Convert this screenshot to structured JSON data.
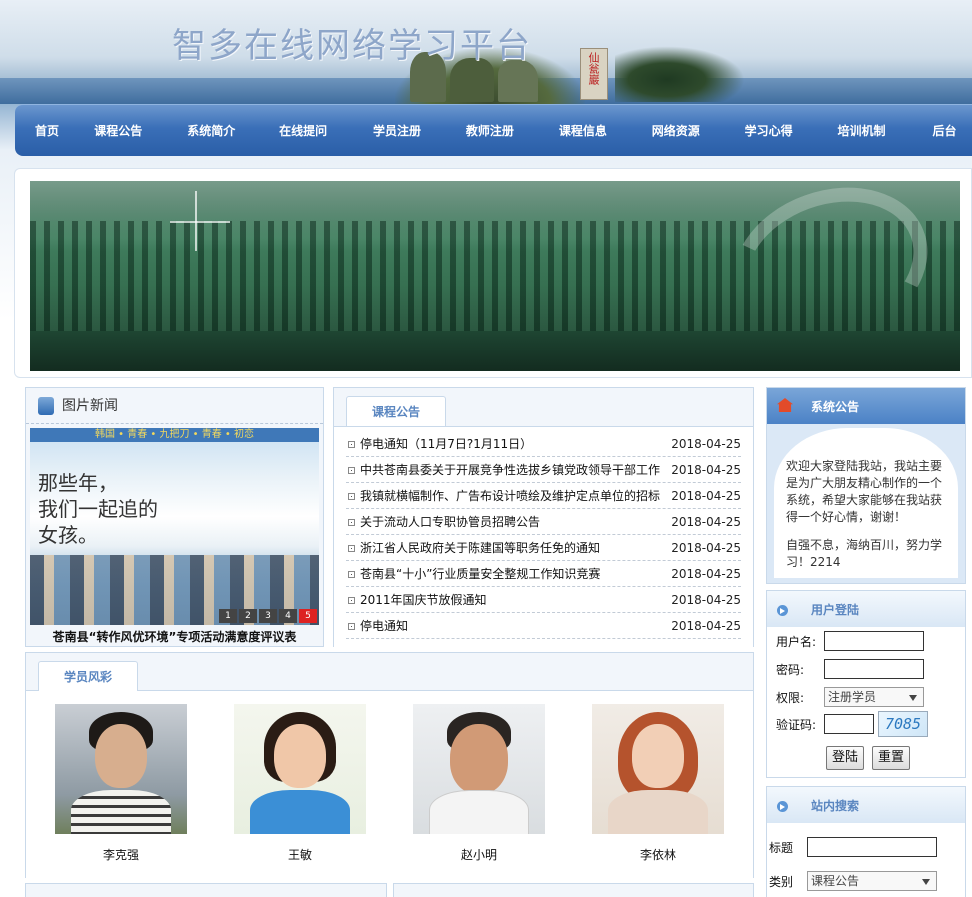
{
  "header": {
    "site_title": "智多在线网络学习平台",
    "stele_text": "仙瓮巖"
  },
  "nav": {
    "items": [
      "首页",
      "课程公告",
      "系统简介",
      "在线提问",
      "学员注册",
      "教师注册",
      "课程信息",
      "网络资源",
      "学习心得",
      "培训机制",
      "后台"
    ]
  },
  "picture_news": {
    "title": "图片新闻",
    "poster_topbar": "韩国 • 青春 • 九把刀 • 青春 • 初恋",
    "poster_script": "那些年，\n我们一起追的\n女孩。",
    "pager": [
      "1",
      "2",
      "3",
      "4",
      "5"
    ],
    "active_page": 5,
    "caption": "苍南县“转作风优环境”专项活动满意度评议表"
  },
  "course_notices": {
    "tab": "课程公告",
    "items": [
      {
        "title": "停电通知（11月7日?1月11日）",
        "date": "2018-04-25"
      },
      {
        "title": "中共苍南县委关于开展竞争性选拔乡镇党政领导干部工作",
        "date": "2018-04-25"
      },
      {
        "title": "我镇就横幅制作、广告布设计喷绘及维护定点单位的招标",
        "date": "2018-04-25"
      },
      {
        "title": "关于流动人口专职协管员招聘公告",
        "date": "2018-04-25"
      },
      {
        "title": "浙江省人民政府关于陈建国等职务任免的通知",
        "date": "2018-04-25"
      },
      {
        "title": "苍南县“十小”行业质量安全整规工作知识竞赛",
        "date": "2018-04-25"
      },
      {
        "title": "2011年国庆节放假通知",
        "date": "2018-04-25"
      },
      {
        "title": "停电通知",
        "date": "2018-04-25"
      }
    ]
  },
  "students": {
    "tab": "学员风彩",
    "items": [
      {
        "name": "李克强"
      },
      {
        "name": "王敏"
      },
      {
        "name": "赵小明"
      },
      {
        "name": "李依林"
      }
    ]
  },
  "system_notice": {
    "title": "系统公告",
    "para1": "欢迎大家登陆我站，我站主要是为广大朋友精心制作的一个系统，希望大家能够在我站获得一个好心情，谢谢！",
    "para2": "自强不息，海纳百川，努力学习！2214"
  },
  "login": {
    "title": "用户登陆",
    "username_label": "用户名:",
    "password_label": "密码:",
    "role_label": "权限:",
    "role_value": "注册学员",
    "captcha_label": "验证码:",
    "captcha_text": "7085",
    "login_button": "登陆",
    "reset_button": "重置"
  },
  "search": {
    "title": "站内搜索",
    "title_label": "标题",
    "category_label": "类别",
    "category_value": "课程公告"
  }
}
